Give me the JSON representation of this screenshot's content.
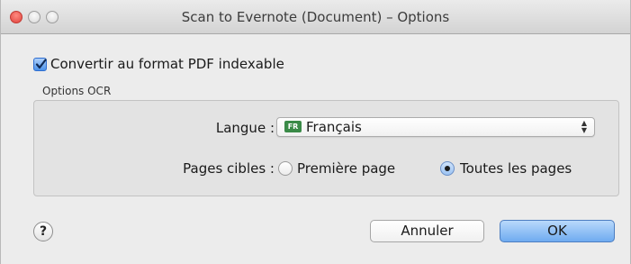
{
  "window": {
    "title": "Scan to Evernote (Document) – Options",
    "accent_color": "#4b92ea"
  },
  "pdf_option": {
    "label": "Convertir au format PDF indexable",
    "checked": true
  },
  "ocr_group": {
    "caption": "Options OCR",
    "language": {
      "label": "Langue :",
      "flag_text": "FR",
      "value": "Français"
    },
    "pages": {
      "label": "Pages cibles :",
      "options": [
        {
          "label": "Première page",
          "selected": false
        },
        {
          "label": "Toutes les pages",
          "selected": true
        }
      ]
    }
  },
  "footer": {
    "help_label": "?",
    "cancel_label": "Annuler",
    "ok_label": "OK"
  }
}
